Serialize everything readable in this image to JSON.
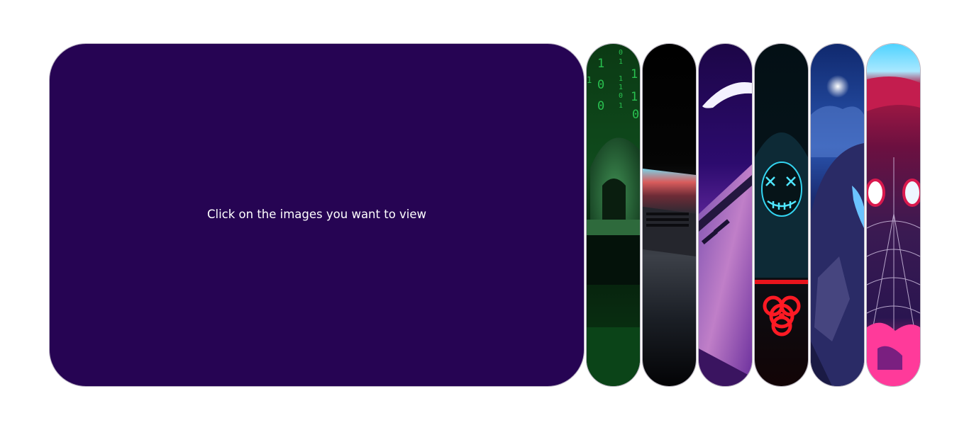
{
  "viewer": {
    "placeholder_text": "Click on the images you want to view",
    "background_color": "#260453"
  },
  "thumbnails": [
    {
      "icon": "hooded-hacker-matrix-icon"
    },
    {
      "icon": "laptop-dark-icon"
    },
    {
      "icon": "laptop-purple-icon"
    },
    {
      "icon": "neon-mask-biohazard-icon"
    },
    {
      "icon": "hooded-figure-night-icon"
    },
    {
      "icon": "spider-man-mask-icon"
    }
  ]
}
